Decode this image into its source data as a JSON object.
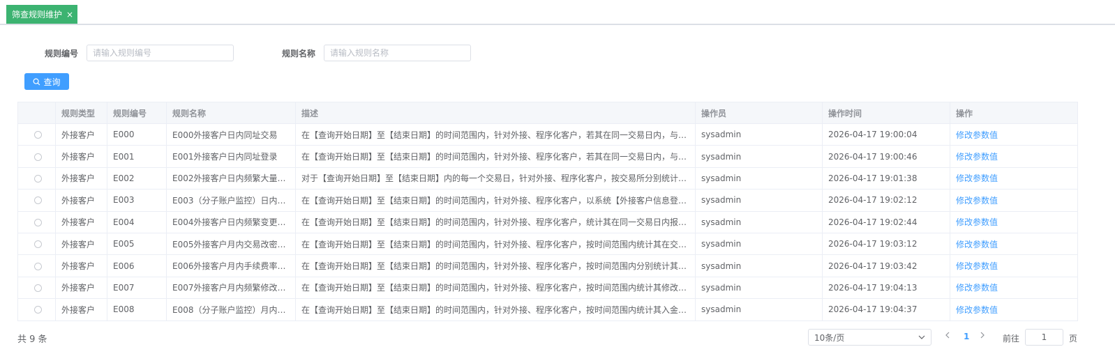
{
  "tab": {
    "title": "筛查规则维护",
    "close": "×"
  },
  "search": {
    "code_label": "规则编号",
    "code_placeholder": "请输入规则编号",
    "name_label": "规则名称",
    "name_placeholder": "请输入规则名称",
    "query_button": "查询"
  },
  "table": {
    "columns": [
      "",
      "规则类型",
      "规则编号",
      "规则名称",
      "描述",
      "操作员",
      "操作时间",
      "操作"
    ],
    "rows": [
      {
        "type": "外接客户",
        "code": "E000",
        "name": "E000外接客户日内同址交易",
        "desc": "在【查询开始日期】至【结束日期】的时间范围内，针对外接、程序化客户，若其在同一交易日内，与其…",
        "operator": "sysadmin",
        "time": "2026-04-17 19:00:04",
        "action": "修改参数值"
      },
      {
        "type": "外接客户",
        "code": "E001",
        "name": "E001外接客户日内同址登录",
        "desc": "在【查询开始日期】至【结束日期】的时间范围内，针对外接、程序化客户，若其在同一交易日内，与其…",
        "operator": "sysadmin",
        "time": "2026-04-17 19:00:46",
        "action": "修改参数值"
      },
      {
        "type": "外接客户",
        "code": "E002",
        "name": "E002外接客户日内频繁大量…",
        "desc": "对于【查询开始日期】至【结束日期】内的每一个交易日，针对外接、程序化客户，按交易所分别统计外…",
        "operator": "sysadmin",
        "time": "2026-04-17 19:01:38",
        "action": "修改参数值"
      },
      {
        "type": "外接客户",
        "code": "E003",
        "name": "E003（分子账户监控）日内…",
        "desc": "在【查询开始日期】至【结束日期】的时间范围内，针对外接、程序化客户，以系统【外接客户信息登记…",
        "operator": "sysadmin",
        "time": "2026-04-17 19:02:12",
        "action": "修改参数值"
      },
      {
        "type": "外接客户",
        "code": "E004",
        "name": "E004外接客户日内频繁变更…",
        "desc": "在【查询开始日期】至【结束日期】的时间范围内，针对外接、程序化客户，统计其在同一交易日内报单…",
        "operator": "sysadmin",
        "time": "2026-04-17 19:02:44",
        "action": "修改参数值"
      },
      {
        "type": "外接客户",
        "code": "E005",
        "name": "E005外接客户月内交易改密…",
        "desc": "在【查询开始日期】至【结束日期】的时间范围内，针对外接、程序化客户，按时间范围内统计其在交易…",
        "operator": "sysadmin",
        "time": "2026-04-17 19:03:12",
        "action": "修改参数值"
      },
      {
        "type": "外接客户",
        "code": "E006",
        "name": "E006外接客户月内手续费率…",
        "desc": "在【查询开始日期】至【结束日期】的时间范围内，针对外接、程序化客户，按时间范围内分别统计其手…",
        "operator": "sysadmin",
        "time": "2026-04-17 19:03:42",
        "action": "修改参数值"
      },
      {
        "type": "外接客户",
        "code": "E007",
        "name": "E007外接客户月内频繁修改…",
        "desc": "在【查询开始日期】至【结束日期】的时间范围内，针对外接、程序化客户，按时间范围内统计其修改密…",
        "operator": "sysadmin",
        "time": "2026-04-17 19:04:13",
        "action": "修改参数值"
      },
      {
        "type": "外接客户",
        "code": "E008",
        "name": "E008（分子账户监控）月内…",
        "desc": "在【查询开始日期】至【结束日期】的时间范围内，针对外接、程序化客户，按时间范围内统计其入金与…",
        "operator": "sysadmin",
        "time": "2026-04-17 19:04:37",
        "action": "修改参数值"
      }
    ]
  },
  "pagination": {
    "total": "共 9 条",
    "page_size": "10条/页",
    "current_page": "1",
    "goto_label": "前往",
    "goto_value": "1",
    "goto_unit": "页"
  },
  "colors": {
    "tab_bg": "#3cb371",
    "primary": "#409eff"
  }
}
